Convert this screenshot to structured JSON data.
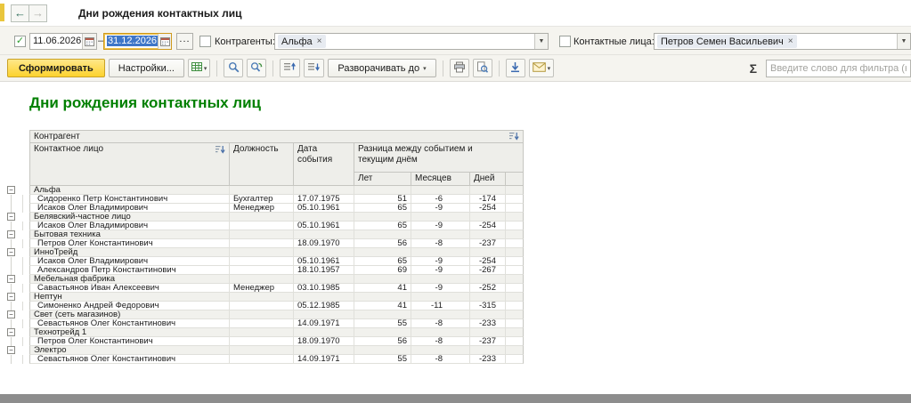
{
  "colors": {
    "accent_yellow": "#fcd22e",
    "report_title_green": "#008000",
    "selection_blue": "#3e76c8",
    "toolbar_bg": "#f5f4ef"
  },
  "icons": {
    "back": "←",
    "forward": "→",
    "dropdown": "▾",
    "combo_arrow": "▼",
    "remove_tag": "×",
    "ellipsis": "...",
    "dash": "–",
    "check": "✓",
    "collapse": "−"
  },
  "window": {
    "title": "Дни рождения контактных лиц"
  },
  "filterbar": {
    "period": {
      "checked": true,
      "date_from": "11.06.2026",
      "date_to": "31.12.2026"
    },
    "counterparties": {
      "label": "Контрагенты:",
      "checked": false,
      "value": "Альфа"
    },
    "contacts": {
      "label": "Контактные лица:",
      "checked": false,
      "value": "Петров Семен Васильевич"
    }
  },
  "toolbar": {
    "generate": "Сформировать",
    "settings": "Настройки...",
    "expand_to": "Разворачивать до",
    "sigma": "Σ",
    "filter_placeholder": "Введите слово для фильтра (название товара"
  },
  "report": {
    "title": "Дни рождения контактных лиц",
    "header": {
      "group_column": "Контрагент",
      "contact": "Контактное лицо",
      "position": "Должность",
      "event_date": "Дата события",
      "difference": "Разница между событием и текущим днём",
      "years": "Лет",
      "months": "Месяцев",
      "days": "Дней"
    },
    "groups": [
      {
        "name": "Альфа",
        "rows": [
          {
            "contact": "Сидоренко Петр Константинович",
            "position": "Бухгалтер",
            "date": "17.07.1975",
            "years": "51",
            "months": "-6",
            "days": "-174"
          },
          {
            "contact": "Исаков Олег Владимирович",
            "position": "Менеджер",
            "date": "05.10.1961",
            "years": "65",
            "months": "-9",
            "days": "-254"
          }
        ]
      },
      {
        "name": "Белявский-частное лицо",
        "rows": [
          {
            "contact": "Исаков Олег Владимирович",
            "position": "",
            "date": "05.10.1961",
            "years": "65",
            "months": "-9",
            "days": "-254"
          }
        ]
      },
      {
        "name": "Бытовая техника",
        "rows": [
          {
            "contact": "Петров Олег Константинович",
            "position": "",
            "date": "18.09.1970",
            "years": "56",
            "months": "-8",
            "days": "-237"
          }
        ]
      },
      {
        "name": "ИнноТрейд",
        "rows": [
          {
            "contact": "Исаков Олег Владимирович",
            "position": "",
            "date": "05.10.1961",
            "years": "65",
            "months": "-9",
            "days": "-254"
          },
          {
            "contact": "Александров Петр Константинович",
            "position": "",
            "date": "18.10.1957",
            "years": "69",
            "months": "-9",
            "days": "-267"
          }
        ]
      },
      {
        "name": "Мебельная фабрика",
        "rows": [
          {
            "contact": "Савастьянов Иван Алексеевич",
            "position": "Менеджер",
            "date": "03.10.1985",
            "years": "41",
            "months": "-9",
            "days": "-252"
          }
        ]
      },
      {
        "name": "Нептун",
        "rows": [
          {
            "contact": "Симоненко Андрей Федорович",
            "position": "",
            "date": "05.12.1985",
            "years": "41",
            "months": "-11",
            "days": "-315"
          }
        ]
      },
      {
        "name": "Свет (сеть магазинов)",
        "rows": [
          {
            "contact": "Севастьянов Олег Константинович",
            "position": "",
            "date": "14.09.1971",
            "years": "55",
            "months": "-8",
            "days": "-233"
          }
        ]
      },
      {
        "name": "Технотрейд 1",
        "rows": [
          {
            "contact": "Петров Олег Константинович",
            "position": "",
            "date": "18.09.1970",
            "years": "56",
            "months": "-8",
            "days": "-237"
          }
        ]
      },
      {
        "name": "Электро",
        "rows": [
          {
            "contact": "Севастьянов Олег Константинович",
            "position": "",
            "date": "14.09.1971",
            "years": "55",
            "months": "-8",
            "days": "-233"
          }
        ]
      }
    ]
  }
}
